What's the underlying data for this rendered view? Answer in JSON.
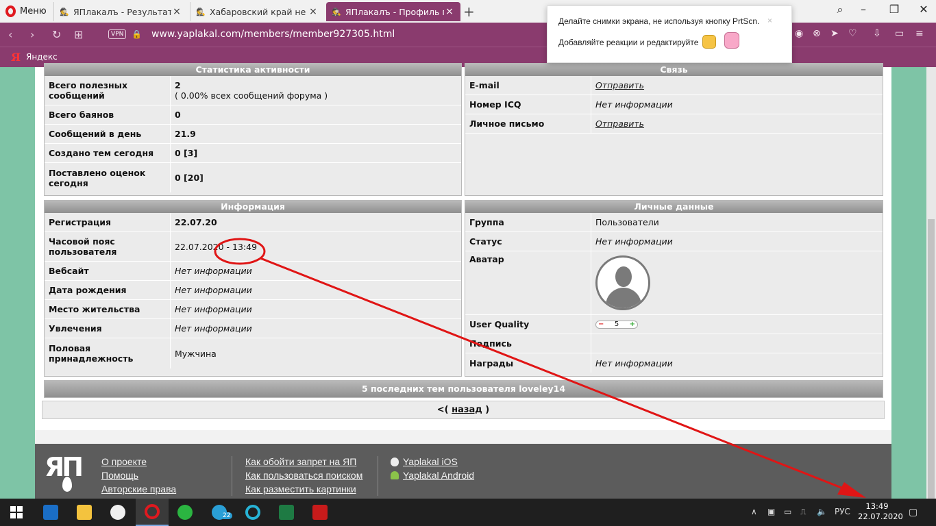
{
  "browser": {
    "menu_label": "Меню",
    "tabs": [
      {
        "title": "ЯПлакалъ - Результаты по",
        "icon": "incognito-icon"
      },
      {
        "title": "Хабаровский край не сдае",
        "icon": "incognito-icon"
      },
      {
        "title": "ЯПлакалъ - Профиль поль",
        "icon": "incognito-icon"
      }
    ],
    "vpn_label": "VPN",
    "url": "www.yaplakal.com/members/member927305.html",
    "bookmark_logo": "Я",
    "bookmark_label": "Яндекс",
    "accent": "#8a3b6e"
  },
  "popup": {
    "line1": "Делайте снимки экрана, не используя кнопку PrtScn.",
    "line2": "Добавляйте реакции и редактируйте",
    "close": "×"
  },
  "profile": {
    "stats": {
      "title": "Статистика активности",
      "rows": [
        {
          "k": "Всего полезных сообщений",
          "v": "2",
          "v2": "( 0.00% всех сообщений форума )"
        },
        {
          "k": "Всего баянов",
          "v": "0"
        },
        {
          "k": "Сообщений в день",
          "v": "21.9"
        },
        {
          "k": "Создано тем сегодня",
          "v": "0 [3]"
        },
        {
          "k": "Поставлено оценок сегодня",
          "v": "0 [20]"
        }
      ]
    },
    "contact": {
      "title": "Связь",
      "rows": [
        {
          "k": "E-mail",
          "v": "Отправить"
        },
        {
          "k": "Номер ICQ",
          "v": "Нет информации"
        },
        {
          "k": "Личное письмо",
          "v": "Отправить"
        }
      ]
    },
    "info": {
      "title": "Информация",
      "rows": [
        {
          "k": "Регистрация",
          "v": "22.07.20"
        },
        {
          "k": "Часовой пояс пользователя",
          "v": "22.07.2020 - 13:49"
        },
        {
          "k": "Вебсайт",
          "v": "Нет информации"
        },
        {
          "k": "Дата рождения",
          "v": "Нет информации"
        },
        {
          "k": "Место жительства",
          "v": "Нет информации"
        },
        {
          "k": "Увлечения",
          "v": "Нет информации"
        },
        {
          "k": "Половая принадлежность",
          "v": "Мужчина"
        }
      ]
    },
    "personal": {
      "title": "Личные данные",
      "rows": [
        {
          "k": "Группа",
          "v": "Пользователи"
        },
        {
          "k": "Статус",
          "v": "Нет информации"
        },
        {
          "k": "Аватар",
          "v": ""
        },
        {
          "k": "User Quality",
          "v": "5",
          "minus": "−",
          "plus": "+"
        },
        {
          "k": "Подпись",
          "v": ""
        },
        {
          "k": "Награды",
          "v": "Нет информации"
        }
      ]
    },
    "last_topics": "5 последних тем пользователя loveley14",
    "back_prefix": "<(",
    "back_link": "назад",
    "back_suffix": ")"
  },
  "footer": {
    "logo": "ЯП",
    "col1": [
      "О проекте",
      "Помощь",
      "Авторские права"
    ],
    "col2": [
      "Как обойти запрет на ЯП",
      "Как пользоваться поиском",
      "Как разместить картинки"
    ],
    "col3": [
      "Yaplakal iOS",
      "Yaplakal Android"
    ]
  },
  "taskbar": {
    "telegram_badge": "22",
    "lang": "РУС",
    "time": "13:49",
    "date": "22.07.2020"
  }
}
